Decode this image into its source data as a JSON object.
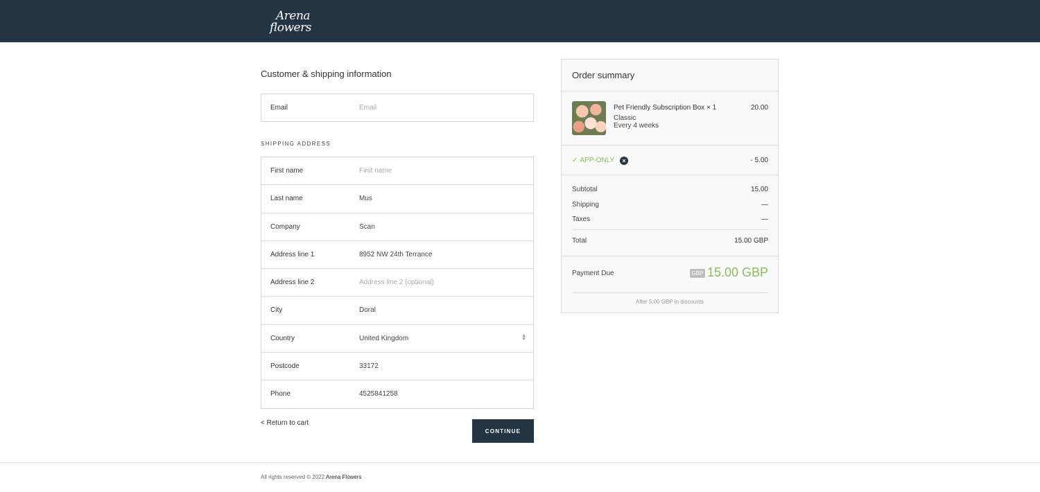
{
  "header": {
    "logo_line1": "Arena",
    "logo_line2": "flowers",
    "bg_color": "#233442"
  },
  "form": {
    "title": "Customer & shipping information",
    "email": {
      "label": "Email",
      "placeholder": "Email"
    },
    "shipping_label": "SHIPPING ADDRESS",
    "fields": [
      {
        "label": "First name",
        "value": "",
        "placeholder": "First name"
      },
      {
        "label": "Last name",
        "value": "Mus"
      },
      {
        "label": "Company",
        "value": "Scan"
      },
      {
        "label": "Address line 1",
        "value": "8952 NW 24th Terrance"
      },
      {
        "label": "Address line 2",
        "value": "",
        "placeholder": "Address line 2 (optional)"
      },
      {
        "label": "City",
        "value": "Doral"
      },
      {
        "label": "Country",
        "value": "United Kingdom"
      },
      {
        "label": "Postcode",
        "value": "33172"
      },
      {
        "label": "Phone",
        "value": "4525841258"
      }
    ],
    "return_link": "< Return to cart",
    "continue_label": "CONTINUE"
  },
  "summary": {
    "title": "Order summary",
    "item": {
      "name": "Pet Friendly Subscription Box × 1",
      "variant": "Classic",
      "frequency": "Every 4 weeks",
      "price": "20.00",
      "image_icon": "flower-bouquet-image"
    },
    "discount": {
      "code": "APP-ONLY",
      "amount": "- 5.00",
      "check_icon": "✓",
      "remove_icon": "×"
    },
    "subtotal_label": "Subtotal",
    "subtotal": "15.00",
    "shipping_label": "Shipping",
    "shipping": "—",
    "taxes_label": "Taxes",
    "taxes": "—",
    "total_label": "Total",
    "total": "15.00 GBP",
    "payment_due_label": "Payment Due",
    "currency_badge": "GBP",
    "payment_due": "15.00 GBP",
    "discount_note": "After 5.00 GBP in discounts",
    "accent_color": "#8cbc5c"
  },
  "footer": {
    "text": "All rights reserved © 2022",
    "brand": "Arena Flowers"
  }
}
